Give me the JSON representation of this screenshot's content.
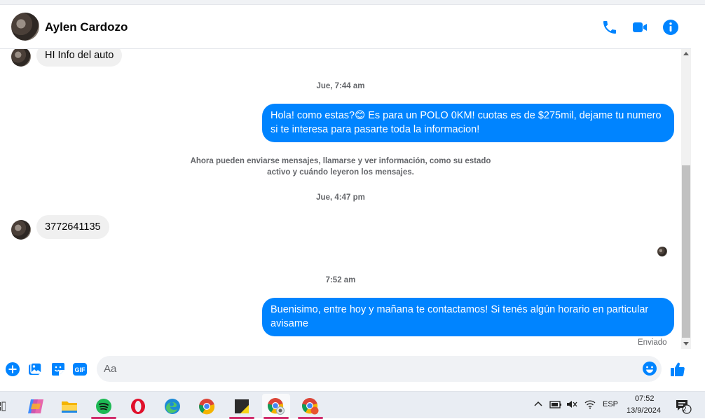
{
  "header": {
    "contact_name": "Aylen Cardozo",
    "icons": [
      "phone-icon",
      "video-camera-icon",
      "info-icon"
    ]
  },
  "conversation": {
    "msg1": "HI Info del auto",
    "ts1": "Jue, 7:44 am",
    "msg2": "Hola! como estas?😊 Es para un POLO 0KM! cuotas es de $275mil, dejame tu numero si te interesa para pasarte toda la informacion!",
    "info": "Ahora pueden enviarse mensajes, llamarse y ver información, como su estado activo y cuándo leyeron los mensajes.",
    "ts2": "Jue, 4:47 pm",
    "msg3": "3772641135",
    "ts3": "7:52 am",
    "msg4": "Buenisimo, entre hoy y mañana te contactamos! Si tenés algún horario en particular avisame",
    "status": "Enviado"
  },
  "composer": {
    "placeholder": "Aa",
    "icons": [
      "plus-icon",
      "image-icon",
      "sticker-icon",
      "gif-icon",
      "emoji-icon",
      "thumbs-up-icon"
    ],
    "gif_label": "GIF"
  },
  "taskbar": {
    "apps": [
      "copilot-icon",
      "file-explorer-icon",
      "spotify-icon",
      "opera-icon",
      "edge-icon",
      "chrome-icon",
      "sticky-app-icon",
      "chrome-profile-icon",
      "chrome-profile-2-icon"
    ],
    "lang": "ESP",
    "time": "07:52",
    "date": "13/9/2024",
    "notif_count": "2"
  },
  "colors": {
    "accent": "#0084ff",
    "bubble_in": "#f0f0f0",
    "meta_text": "#65676b"
  }
}
